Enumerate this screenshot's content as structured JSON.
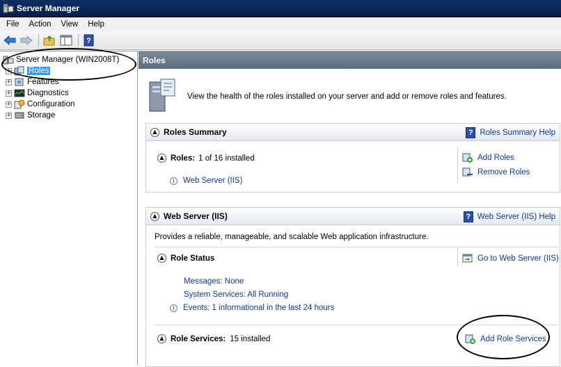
{
  "window": {
    "title": "Server Manager"
  },
  "menu": [
    "File",
    "Action",
    "View",
    "Help"
  ],
  "tree": {
    "root": "Server Manager (WIN2008T)",
    "items": [
      {
        "label": "Roles",
        "selected": true
      },
      {
        "label": "Features"
      },
      {
        "label": "Diagnostics"
      },
      {
        "label": "Configuration"
      },
      {
        "label": "Storage"
      }
    ]
  },
  "content": {
    "header": "Roles",
    "intro": "View the health of the roles installed on your server and add or remove roles and features.",
    "roles_summary": {
      "title": "Roles Summary",
      "help": "Roles Summary Help",
      "roles_label": "Roles:",
      "roles_count": "1 of 16 installed",
      "installed_role": "Web Server (IIS)",
      "add_roles": "Add Roles",
      "remove_roles": "Remove Roles"
    },
    "web_server": {
      "title": "Web Server (IIS)",
      "help": "Web Server (IIS) Help",
      "description": "Provides a reliable, manageable, and scalable Web application infrastructure.",
      "role_status_title": "Role Status",
      "goto": "Go to Web Server (IIS)",
      "messages": "Messages: None",
      "system_services": "System Services: All Running",
      "events": "Events: 1 informational in the last 24 hours",
      "role_services_label": "Role Services:",
      "role_services_count": "15 installed",
      "add_role_services": "Add Role Services"
    }
  },
  "colors": {
    "titlebar": "#0a2558",
    "link": "#0a3aa6",
    "selection": "#3399ff",
    "content_header": "#6b7b8e"
  }
}
